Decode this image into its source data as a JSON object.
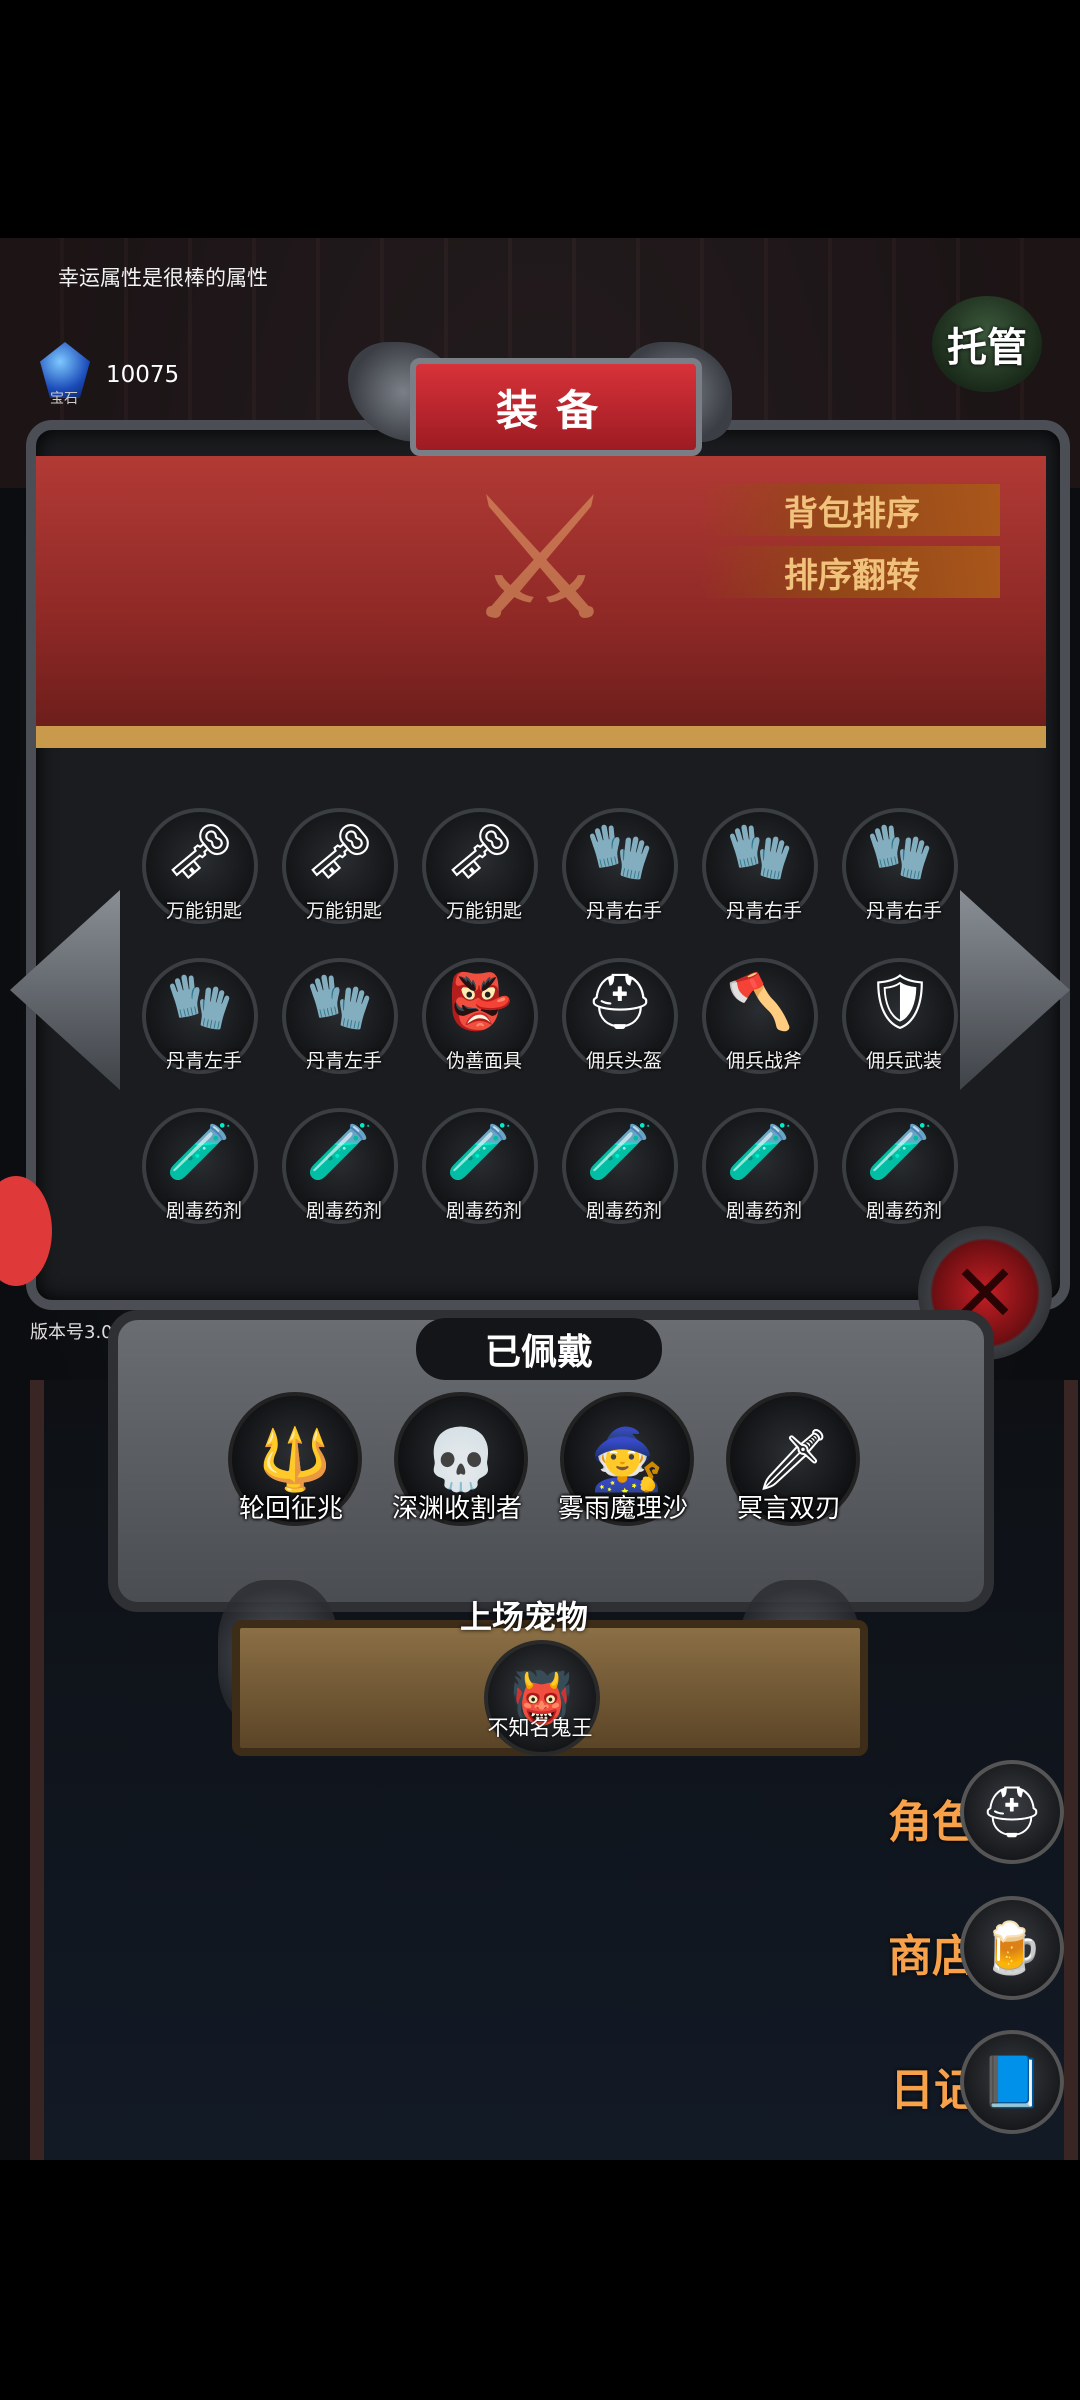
{
  "hud": {
    "tip": "幸运属性是很棒的属性",
    "gem_label": "宝石",
    "gem_count": "10075",
    "auto_button": "托管"
  },
  "panel": {
    "title": "装备",
    "sort_bag": "背包排序",
    "sort_reverse": "排序翻转"
  },
  "items": [
    {
      "label": "万能钥匙",
      "icon": "key-icon"
    },
    {
      "label": "万能钥匙",
      "icon": "key-icon"
    },
    {
      "label": "万能钥匙",
      "icon": "key-icon"
    },
    {
      "label": "丹青右手",
      "icon": "glove-icon"
    },
    {
      "label": "丹青右手",
      "icon": "glove-icon"
    },
    {
      "label": "丹青右手",
      "icon": "glove-icon"
    },
    {
      "label": "丹青左手",
      "icon": "glove-icon"
    },
    {
      "label": "丹青左手",
      "icon": "glove-icon"
    },
    {
      "label": "伪善面具",
      "icon": "mask-icon"
    },
    {
      "label": "佣兵头盔",
      "icon": "helmet-icon"
    },
    {
      "label": "佣兵战斧",
      "icon": "axe-icon"
    },
    {
      "label": "佣兵武装",
      "icon": "armor-icon"
    },
    {
      "label": "剧毒药剂",
      "icon": "potion-icon"
    },
    {
      "label": "剧毒药剂",
      "icon": "potion-icon"
    },
    {
      "label": "剧毒药剂",
      "icon": "potion-icon"
    },
    {
      "label": "剧毒药剂",
      "icon": "potion-icon"
    },
    {
      "label": "剧毒药剂",
      "icon": "potion-icon"
    },
    {
      "label": "剧毒药剂",
      "icon": "potion-icon"
    }
  ],
  "version": "版本号3.03",
  "equipped": {
    "title": "已佩戴",
    "slots": [
      {
        "label": "轮回征兆",
        "icon": "staff-icon"
      },
      {
        "label": "深渊收割者",
        "icon": "reaper-icon"
      },
      {
        "label": "雾雨魔理沙",
        "icon": "witch-icon"
      },
      {
        "label": "冥言双刃",
        "icon": "blades-icon"
      }
    ]
  },
  "pet": {
    "title": "上场宠物",
    "name": "不知名鬼王"
  },
  "menu": {
    "role": "角色",
    "shop": "商店",
    "diary": "日记"
  },
  "colors": {
    "banner_red": "#9e2e2a",
    "menu_orange": "#f7a24a",
    "sort_gold": "#f1c27c"
  }
}
